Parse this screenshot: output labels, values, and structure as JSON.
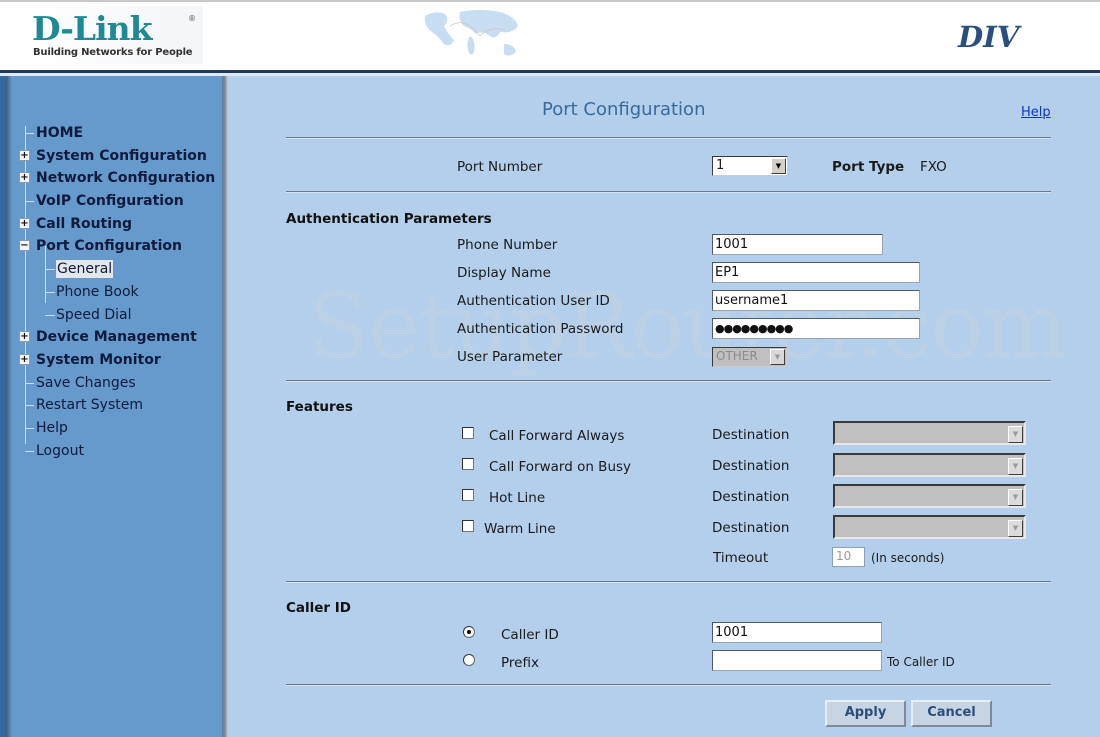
{
  "header": {
    "logo_text": "D-Link",
    "logo_registered": "®",
    "logo_tagline": "Building Networks for People",
    "model": "DIV"
  },
  "sidebar": {
    "items": [
      {
        "label": "HOME",
        "level": 0,
        "expander": null,
        "bold": true
      },
      {
        "label": "System Configuration",
        "level": 0,
        "expander": "+",
        "bold": true
      },
      {
        "label": "Network Configuration",
        "level": 0,
        "expander": "+",
        "bold": true
      },
      {
        "label": "VoIP Configuration",
        "level": 0,
        "expander": null,
        "bold": true
      },
      {
        "label": "Call Routing",
        "level": 0,
        "expander": "+",
        "bold": true
      },
      {
        "label": "Port Configuration",
        "level": 0,
        "expander": "-",
        "bold": true
      },
      {
        "label": "General",
        "level": 1,
        "expander": null,
        "bold": false,
        "active": true
      },
      {
        "label": "Phone Book",
        "level": 1,
        "expander": null,
        "bold": false
      },
      {
        "label": "Speed Dial",
        "level": 1,
        "expander": null,
        "bold": false
      },
      {
        "label": "Device Management",
        "level": 0,
        "expander": "+",
        "bold": true
      },
      {
        "label": "System Monitor",
        "level": 0,
        "expander": "+",
        "bold": true
      },
      {
        "label": "Save Changes",
        "level": 0,
        "expander": null,
        "bold": false
      },
      {
        "label": "Restart System",
        "level": 0,
        "expander": null,
        "bold": false
      },
      {
        "label": "Help",
        "level": 0,
        "expander": null,
        "bold": false
      },
      {
        "label": "Logout",
        "level": 0,
        "expander": null,
        "bold": false
      }
    ]
  },
  "main": {
    "title": "Port Configuration",
    "help_link": "Help",
    "watermark": "SetupRouter.com",
    "port_number_label": "Port Number",
    "port_number_value": "1",
    "port_type_label": "Port Type",
    "port_type_value": "FXO",
    "auth": {
      "section_title": "Authentication Parameters",
      "phone_number_label": "Phone Number",
      "phone_number_value": "1001",
      "display_name_label": "Display Name",
      "display_name_value": "EP1",
      "user_id_label": "Authentication User ID",
      "user_id_value": "username1",
      "password_label": "Authentication Password",
      "password_value": "●●●●●●●●●",
      "user_parameter_label": "User Parameter",
      "user_parameter_value": "OTHER"
    },
    "features": {
      "section_title": "Features",
      "items": [
        {
          "label": "Call Forward Always",
          "checked": false,
          "destination_label": "Destination",
          "destination_value": ""
        },
        {
          "label": "Call Forward on Busy",
          "checked": false,
          "destination_label": "Destination",
          "destination_value": ""
        },
        {
          "label": "Hot Line",
          "checked": false,
          "destination_label": "Destination",
          "destination_value": ""
        },
        {
          "label": "Warm Line",
          "checked": false,
          "destination_label": "Destination",
          "destination_value": ""
        }
      ],
      "timeout_label": "Timeout",
      "timeout_value": "10",
      "timeout_unit": "(In seconds)"
    },
    "caller_id": {
      "section_title": "Caller ID",
      "option_caller_id_label": "Caller ID",
      "option_caller_id_selected": true,
      "caller_id_value": "1001",
      "option_prefix_label": "Prefix",
      "option_prefix_selected": false,
      "prefix_value": "",
      "prefix_suffix": "To Caller ID"
    },
    "buttons": {
      "apply": "Apply",
      "cancel": "Cancel"
    }
  }
}
